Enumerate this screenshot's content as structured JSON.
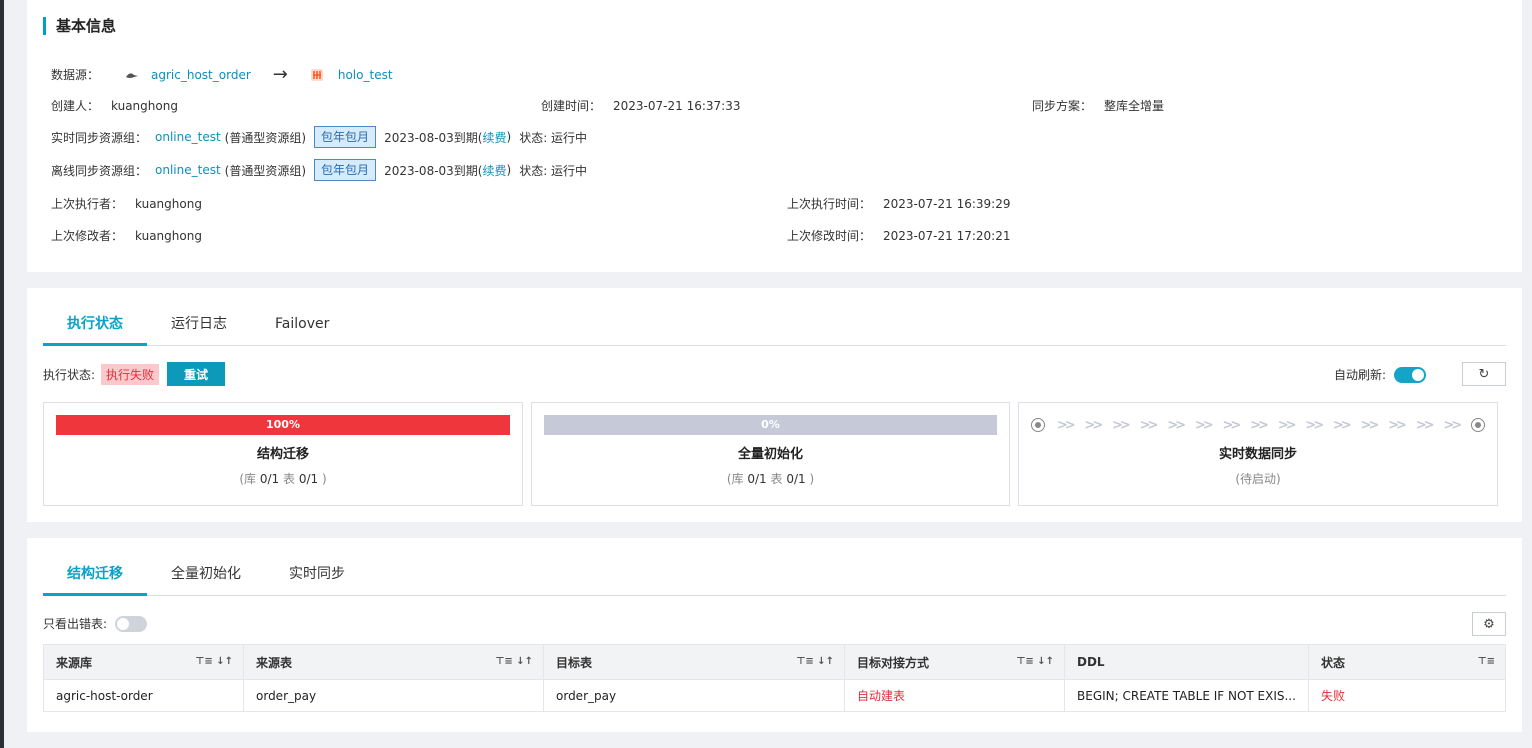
{
  "basic": {
    "title": "基本信息",
    "source_label": "数据源：",
    "source_name": "agric_host_order",
    "target_name": "holo_test",
    "creator_label": "创建人：",
    "creator": "kuanghong",
    "created_label": "创建时间：",
    "created": "2023-07-21 16:37:33",
    "plan_label": "同步方案：",
    "plan": "整库全增量",
    "realtime_label": "实时同步资源组：",
    "offline_label": "离线同步资源组：",
    "group_name": "online_test",
    "group_type": "(普通型资源组)",
    "tag": "包年包月",
    "expire_prefix": "2023-08-03到期(",
    "renew": "续费",
    "expire_suffix": ")",
    "status_text": "状态: 运行中",
    "last_exec_label": "上次执行者：",
    "last_exec": "kuanghong",
    "last_exec_time_label": "上次执行时间：",
    "last_exec_time": "2023-07-21 16:39:29",
    "last_mod_label": "上次修改者：",
    "last_mod": "kuanghong",
    "last_mod_time_label": "上次修改时间：",
    "last_mod_time": "2023-07-21 17:20:21"
  },
  "exec": {
    "tabs": [
      "执行状态",
      "运行日志",
      "Failover"
    ],
    "status_label": "执行状态:",
    "status": "执行失败",
    "retry": "重试",
    "auto_refresh": "自动刷新:",
    "auto_refresh_on": true,
    "panels": [
      {
        "progress_text": "100%",
        "progress": 1.0,
        "title": "结构迁移",
        "sub_prefix": "(库 ",
        "db": "0/1",
        "mid": " 表 ",
        "tbl": "0/1",
        "sub_suffix": " )"
      },
      {
        "progress_text": "0%",
        "progress": 0.0,
        "title": "全量初始化",
        "sub_prefix": "(库 ",
        "db": "0/1",
        "mid": " 表 ",
        "tbl": "0/1",
        "sub_suffix": " )"
      },
      {
        "title": "实时数据同步",
        "sub": "(待启动)"
      }
    ]
  },
  "detail": {
    "tabs": [
      "结构迁移",
      "全量初始化",
      "实时同步"
    ],
    "only_error": "只看出错表:",
    "columns": [
      "来源库",
      "来源表",
      "目标表",
      "目标对接方式",
      "DDL",
      "状态"
    ],
    "rows": [
      {
        "src_db": "agric-host-order",
        "src_tbl": "order_pay",
        "dst_tbl": "order_pay",
        "mode": "自动建表",
        "ddl": "BEGIN; CREATE TABLE IF NOT EXIS...",
        "status": "失败"
      }
    ]
  }
}
